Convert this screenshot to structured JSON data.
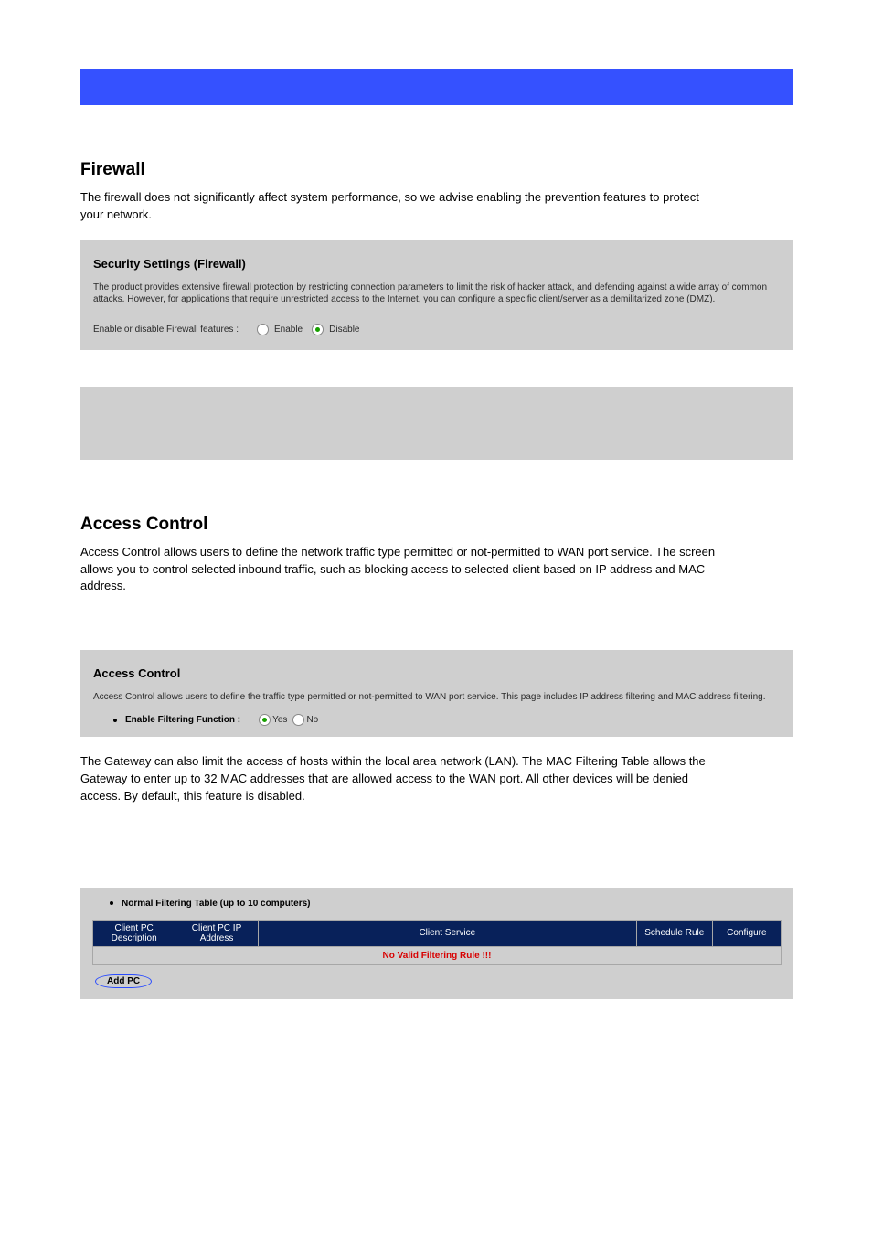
{
  "top_bar": {
    "color": "#3551ff"
  },
  "doc_section_1": {
    "title": "Firewall",
    "p1": "The firewall does not significantly affect system performance, so we advise enabling the prevention features to protect your network."
  },
  "panel1": {
    "heading": "Security Settings (Firewall)",
    "desc": "The product provides extensive firewall protection by restricting connection parameters to limit the risk of hacker attack, and defending against a wide array of common attacks. However, for applications that require unrestricted access to the Internet, you can configure a specific client/server as a demilitarized zone (DMZ).",
    "radio_label": "Enable or disable Firewall features :",
    "opt_enable": "Enable",
    "opt_disable": "Disable",
    "selected": "disable"
  },
  "doc_section_2": {
    "title": "Access Control",
    "p1": "Access Control allows users to define the network traffic type permitted or not-permitted to WAN port service. The screen allows you to control selected inbound traffic, such as blocking access to selected client based on IP address and MAC address."
  },
  "panel_ac": {
    "heading": "Access Control",
    "desc": "Access Control allows users to define the traffic type permitted or not-permitted to WAN port service. This page includes IP address filtering and MAC address filtering.",
    "filter_label": "Enable Filtering Function :",
    "opt_yes": "Yes",
    "opt_no": "No",
    "selected": "yes"
  },
  "doc_section_3": {
    "p1": "The Gateway can also limit the access of hosts within the local area network (LAN). The MAC Filtering Table allows the Gateway to enter up to 32 MAC addresses that are allowed access to the WAN port. All other devices will be denied access. By default, this feature is disabled."
  },
  "panel_table": {
    "title": "Normal Filtering Table (up to 10 computers)",
    "cols": [
      "Client PC Description",
      "Client PC IP Address",
      "Client Service",
      "Schedule Rule",
      "Configure"
    ],
    "no_valid_msg": "No Valid Filtering Rule !!!",
    "add_pc": "Add PC"
  }
}
